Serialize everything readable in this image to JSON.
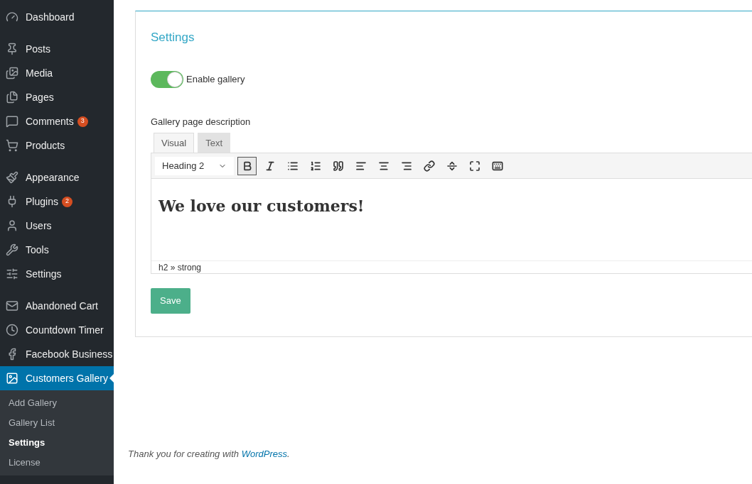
{
  "sidebar": {
    "groups": [
      {
        "items": [
          {
            "label": "Dashboard",
            "selected": false
          }
        ]
      },
      {
        "items": [
          {
            "label": "Posts",
            "selected": false
          },
          {
            "label": "Media",
            "selected": false
          },
          {
            "label": "Pages",
            "selected": false
          },
          {
            "label": "Comments",
            "badge": "3",
            "selected": false
          },
          {
            "label": "Products",
            "selected": false
          }
        ]
      },
      {
        "items": [
          {
            "label": "Appearance",
            "selected": false
          },
          {
            "label": "Plugins",
            "badge": "2",
            "selected": false
          },
          {
            "label": "Users",
            "selected": false
          },
          {
            "label": "Tools",
            "selected": false
          },
          {
            "label": "Settings",
            "selected": false
          }
        ]
      },
      {
        "items": [
          {
            "label": "Abandoned Cart",
            "selected": false
          },
          {
            "label": "Countdown Timer",
            "selected": false
          },
          {
            "label": "Facebook Business",
            "selected": false
          },
          {
            "label": "Customers Gallery",
            "selected": true,
            "children": [
              {
                "label": "Add Gallery",
                "selected": false
              },
              {
                "label": "Gallery List",
                "selected": false
              },
              {
                "label": "Settings",
                "selected": true
              },
              {
                "label": "License",
                "selected": false
              }
            ]
          }
        ]
      }
    ]
  },
  "panel": {
    "title": "Settings",
    "toggle": {
      "label": "Enable gallery",
      "on": true
    },
    "description_label": "Gallery page description",
    "editor": {
      "tabs": [
        {
          "label": "Visual",
          "selected": true
        },
        {
          "label": "Text",
          "selected": false
        }
      ],
      "format": "Heading 2",
      "toolbar_buttons": [
        {
          "active": true
        },
        {
          "active": false
        },
        {
          "active": false
        },
        {
          "active": false
        },
        {
          "active": false
        },
        {
          "active": false
        },
        {
          "active": false
        },
        {
          "active": false
        },
        {
          "active": false
        },
        {
          "active": false
        },
        {
          "active": false
        },
        {
          "active": false
        }
      ],
      "content": "We love our customers!",
      "path": "h2 » strong"
    },
    "save_button": "Save"
  },
  "footer": {
    "text_before": "Thank you for creating with ",
    "link": "WordPress",
    "text_after": "."
  }
}
